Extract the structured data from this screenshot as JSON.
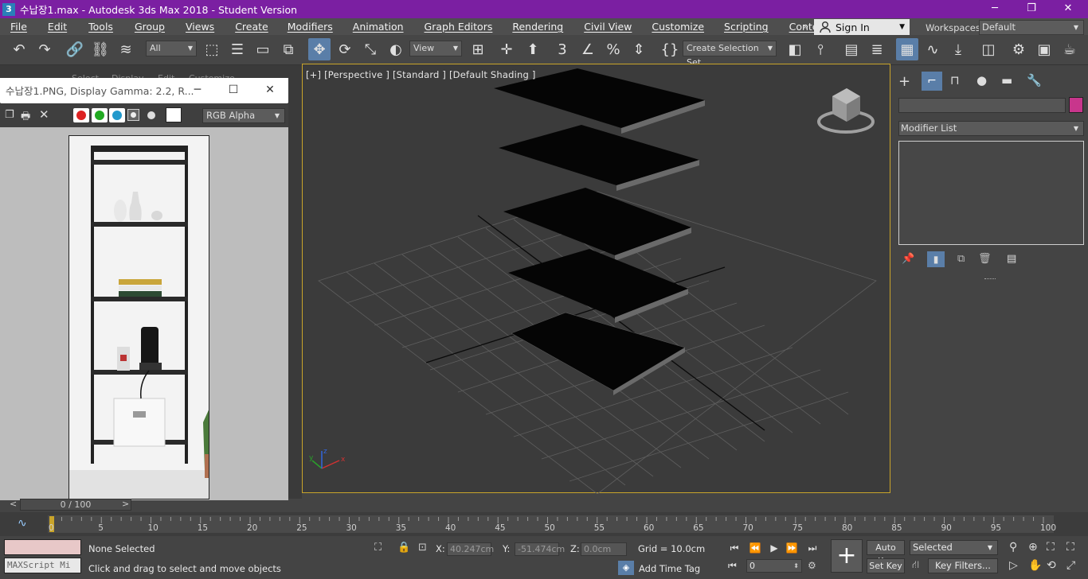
{
  "titlebar": {
    "app_icon": "3",
    "title": "수납장1.max - Autodesk 3ds Max 2018 - Student Version",
    "minimize": "─",
    "restore": "❐",
    "close": "✕"
  },
  "menu": [
    "File",
    "Edit",
    "Tools",
    "Group",
    "Views",
    "Create",
    "Modifiers",
    "Animation",
    "Graph Editors",
    "Rendering",
    "Civil View",
    "Customize",
    "Scripting",
    "Content"
  ],
  "menu_overflow": "»",
  "signin": {
    "label": "Sign In"
  },
  "workspaces": {
    "label": "Workspaces:",
    "value": "Default"
  },
  "toolbar": {
    "filter_value": "All",
    "refcoord_value": "View",
    "selection_set_value": "Create Selection Set"
  },
  "viewport": {
    "label": "[+] [Perspective ] [Standard ] [Default Shading ]",
    "axis_x": "x",
    "axis_y": "y",
    "axis_z": "z"
  },
  "frame_buffer": {
    "title": "수납장1.PNG, Display Gamma: 2.2, R...",
    "channel": "RGB Alpha",
    "behind_tabs": [
      "Select",
      "Display",
      "Edit",
      "Customize"
    ]
  },
  "command_panel": {
    "modifier_list": "Modifier List",
    "object_color": "#c8368c"
  },
  "time": {
    "slider_label": "0 / 100",
    "prev": "<",
    "next": ">",
    "ruler_ticks": [
      "0",
      "5",
      "10",
      "15",
      "20",
      "25",
      "30",
      "35",
      "40",
      "45",
      "50",
      "55",
      "60",
      "65",
      "70",
      "75",
      "80",
      "85",
      "90",
      "95",
      "100"
    ]
  },
  "status": {
    "maxscript": "MAXScript Mi",
    "selection": "None Selected",
    "prompt": "Click and drag to select and move objects",
    "x_label": "X:",
    "x_value": "40.247cm",
    "y_label": "Y:",
    "y_value": "-51.474cm",
    "z_label": "Z:",
    "z_value": "0.0cm",
    "grid": "Grid = 10.0cm",
    "add_time_tag": "Add Time Tag",
    "auto_key": "Auto Key",
    "set_key": "Set Key",
    "selected": "Selected",
    "key_filters": "Key Filters...",
    "frame": "0"
  }
}
